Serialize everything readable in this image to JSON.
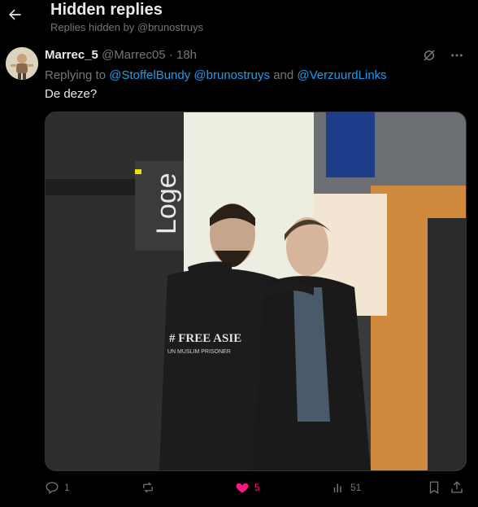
{
  "header": {
    "title": "Hidden replies",
    "subtitle": "Replies hidden by @brunostruys"
  },
  "tweet": {
    "display_name": "Marrec_5",
    "handle": "@Marrec05",
    "time": "18h",
    "separator": "·",
    "replying_prefix": "Replying to",
    "mentions": [
      "@StoffelBundy",
      "@brunostruys",
      "@VerzuurdLinks"
    ],
    "mention_joiner": "and",
    "text": "De deze?",
    "photo": {
      "sign_text": "Loge",
      "shirt_line1": "# FREE ASIE",
      "shirt_line2": "UN MUSLIM PRISONER"
    }
  },
  "actions": {
    "replies": "1",
    "retweets": "",
    "likes": "5",
    "views": "51"
  },
  "colors": {
    "accent": "#1d9bf0",
    "like": "#f91880",
    "muted": "#71767b"
  },
  "icons": [
    "back-arrow-icon",
    "hide-reply-icon",
    "more-icon",
    "reply-icon",
    "retweet-icon",
    "heart-icon",
    "views-icon",
    "bookmark-icon",
    "share-icon"
  ]
}
